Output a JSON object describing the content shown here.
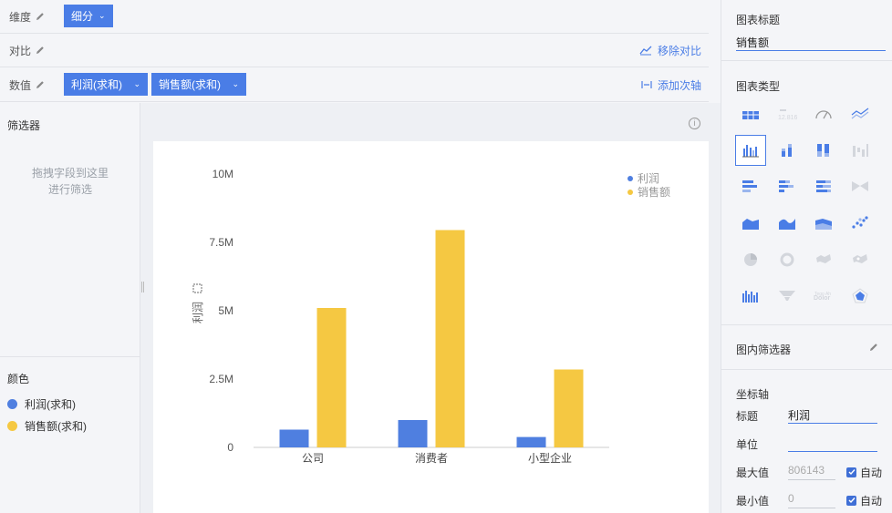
{
  "config": {
    "dimension": {
      "label": "维度",
      "pill": "细分"
    },
    "compare": {
      "label": "对比",
      "action": "移除对比"
    },
    "values": {
      "label": "数值",
      "pills": [
        "利润(求和)",
        "销售额(求和)"
      ],
      "action": "添加次轴"
    }
  },
  "filter": {
    "title": "筛选器",
    "hint_line1": "拖拽字段到这里",
    "hint_line2": "进行筛选"
  },
  "color": {
    "title": "颜色",
    "items": [
      {
        "label": "利润(求和)",
        "color": "#4f7fe0"
      },
      {
        "label": "销售额(求和)",
        "color": "#f5c842"
      }
    ]
  },
  "right_panel": {
    "chart_title_label": "图表标题",
    "chart_title_value": "销售额",
    "chart_type_label": "图表类型",
    "chart_types": [
      "table-icon",
      "kpi-number-icon",
      "gauge-icon",
      "line-icon",
      "grouped-bar-icon",
      "stacked-bar-icon",
      "percent-bar-icon",
      "waterfall-icon",
      "horizontal-bar-icon",
      "horizontal-stacked-bar-icon",
      "horizontal-percent-bar-icon",
      "funnel-butterfly-icon",
      "area-icon",
      "stream-area-icon",
      "stacked-area-icon",
      "scatter-icon",
      "pie-icon",
      "donut-icon",
      "map-icon",
      "bubble-map-icon",
      "histogram-icon",
      "funnel-icon",
      "word-cloud-icon",
      "radar-icon"
    ],
    "selected_type_index": 4,
    "inner_filter_label": "图内筛选器",
    "axis_section_label": "坐标轴",
    "axis_title_key": "标题",
    "axis_title_value": "利润",
    "axis_unit_key": "单位",
    "axis_unit_value": "",
    "axis_max_key": "最大值",
    "axis_max_placeholder": "806143",
    "axis_min_key": "最小值",
    "axis_min_placeholder": "0",
    "auto_label": "自动"
  },
  "chart_data": {
    "type": "bar",
    "categories": [
      "公司",
      "消费者",
      "小型企业"
    ],
    "series": [
      {
        "name": "利润",
        "color": "#4f7fe0",
        "values": [
          650000,
          1000000,
          380000
        ]
      },
      {
        "name": "销售额",
        "color": "#f5c842",
        "values": [
          5100000,
          7950000,
          2850000
        ]
      }
    ],
    "ylabel": "利润",
    "ylim": [
      0,
      10000000
    ],
    "yticks": [
      0,
      2500000,
      5000000,
      7500000,
      10000000
    ],
    "ytick_labels": [
      "0",
      "2.5M",
      "5M",
      "7.5M",
      "10M"
    ],
    "legend_position": "top-right",
    "grid": false
  }
}
